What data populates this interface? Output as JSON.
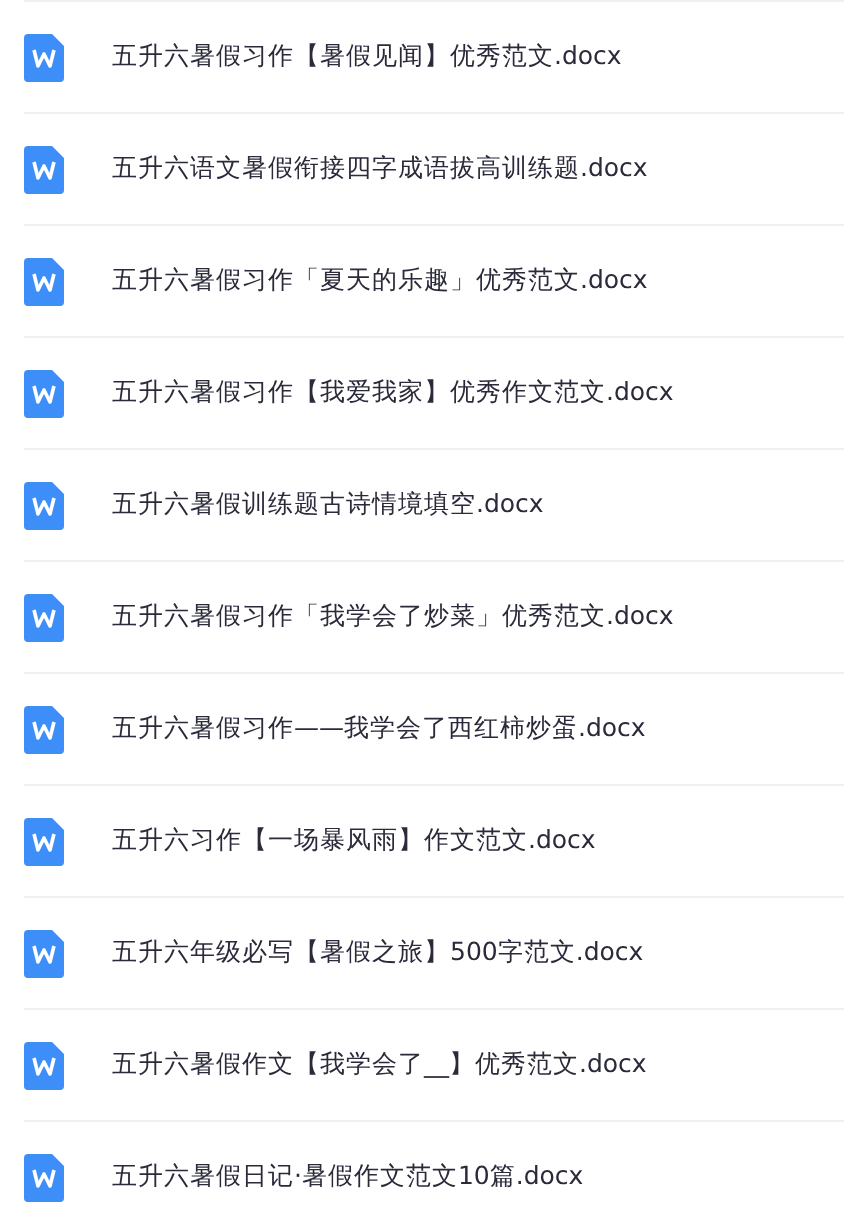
{
  "files": [
    {
      "name": "五升六暑假习作【暑假见闻】优秀范文.docx",
      "kind": "word"
    },
    {
      "name": "五升六语文暑假衔接四字成语拔高训练题.docx",
      "kind": "word"
    },
    {
      "name": "五升六暑假习作「夏天的乐趣」优秀范文.docx",
      "kind": "word"
    },
    {
      "name": "五升六暑假习作【我爱我家】优秀作文范文.docx",
      "kind": "word"
    },
    {
      "name": "五升六暑假训练题古诗情境填空.docx",
      "kind": "word"
    },
    {
      "name": "五升六暑假习作「我学会了炒菜」优秀范文.docx",
      "kind": "word"
    },
    {
      "name": "五升六暑假习作——我学会了西红柿炒蛋.docx",
      "kind": "word"
    },
    {
      "name": "五升六习作【一场暴风雨】作文范文.docx",
      "kind": "word"
    },
    {
      "name": "五升六年级必写【暑假之旅】500字范文.docx",
      "kind": "word"
    },
    {
      "name": "五升六暑假作文【我学会了__】优秀范文.docx",
      "kind": "word"
    },
    {
      "name": "五升六暑假日记·暑假作文范文10篇.docx",
      "kind": "word"
    }
  ]
}
